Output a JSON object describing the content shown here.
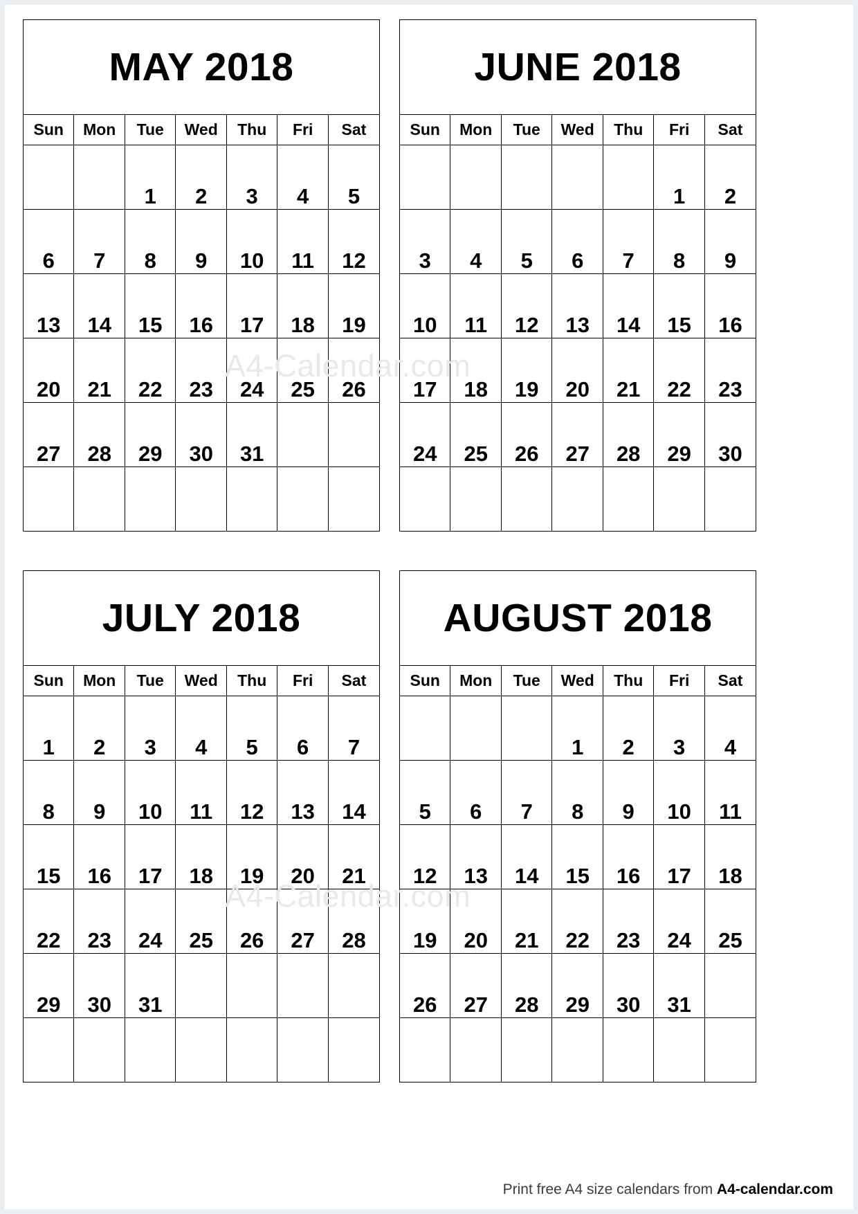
{
  "page": {
    "background_color": "#ffffff",
    "border_color": "#eceff1",
    "text_color": "#000000"
  },
  "watermark": {
    "text": "A4-Calendar.com",
    "color": "#e9e9e9"
  },
  "footer": {
    "prefix": "Print free A4 size calendars from ",
    "brand": "A4-calendar.com"
  },
  "weekdays": [
    "Sun",
    "Mon",
    "Tue",
    "Wed",
    "Thu",
    "Fri",
    "Sat"
  ],
  "calendars": [
    {
      "title": "MAY 2018",
      "month": "May",
      "year": 2018,
      "first_weekday_index": 2,
      "days_in_month": 31,
      "weeks": [
        [
          "",
          "",
          "1",
          "2",
          "3",
          "4",
          "5"
        ],
        [
          "6",
          "7",
          "8",
          "9",
          "10",
          "11",
          "12"
        ],
        [
          "13",
          "14",
          "15",
          "16",
          "17",
          "18",
          "19"
        ],
        [
          "20",
          "21",
          "22",
          "23",
          "24",
          "25",
          "26"
        ],
        [
          "27",
          "28",
          "29",
          "30",
          "31",
          "",
          ""
        ],
        [
          "",
          "",
          "",
          "",
          "",
          "",
          ""
        ]
      ]
    },
    {
      "title": "JUNE 2018",
      "month": "June",
      "year": 2018,
      "first_weekday_index": 5,
      "days_in_month": 30,
      "weeks": [
        [
          "",
          "",
          "",
          "",
          "",
          "1",
          "2"
        ],
        [
          "3",
          "4",
          "5",
          "6",
          "7",
          "8",
          "9"
        ],
        [
          "10",
          "11",
          "12",
          "13",
          "14",
          "15",
          "16"
        ],
        [
          "17",
          "18",
          "19",
          "20",
          "21",
          "22",
          "23"
        ],
        [
          "24",
          "25",
          "26",
          "27",
          "28",
          "29",
          "30"
        ],
        [
          "",
          "",
          "",
          "",
          "",
          "",
          ""
        ]
      ]
    },
    {
      "title": "JULY 2018",
      "month": "July",
      "year": 2018,
      "first_weekday_index": 0,
      "days_in_month": 31,
      "weeks": [
        [
          "1",
          "2",
          "3",
          "4",
          "5",
          "6",
          "7"
        ],
        [
          "8",
          "9",
          "10",
          "11",
          "12",
          "13",
          "14"
        ],
        [
          "15",
          "16",
          "17",
          "18",
          "19",
          "20",
          "21"
        ],
        [
          "22",
          "23",
          "24",
          "25",
          "26",
          "27",
          "28"
        ],
        [
          "29",
          "30",
          "31",
          "",
          "",
          "",
          ""
        ],
        [
          "",
          "",
          "",
          "",
          "",
          "",
          ""
        ]
      ]
    },
    {
      "title": "AUGUST 2018",
      "month": "August",
      "year": 2018,
      "first_weekday_index": 3,
      "days_in_month": 31,
      "weeks": [
        [
          "",
          "",
          "",
          "1",
          "2",
          "3",
          "4"
        ],
        [
          "5",
          "6",
          "7",
          "8",
          "9",
          "10",
          "11"
        ],
        [
          "12",
          "13",
          "14",
          "15",
          "16",
          "17",
          "18"
        ],
        [
          "19",
          "20",
          "21",
          "22",
          "23",
          "24",
          "25"
        ],
        [
          "26",
          "27",
          "28",
          "29",
          "30",
          "31",
          ""
        ],
        [
          "",
          "",
          "",
          "",
          "",
          "",
          ""
        ]
      ]
    }
  ]
}
